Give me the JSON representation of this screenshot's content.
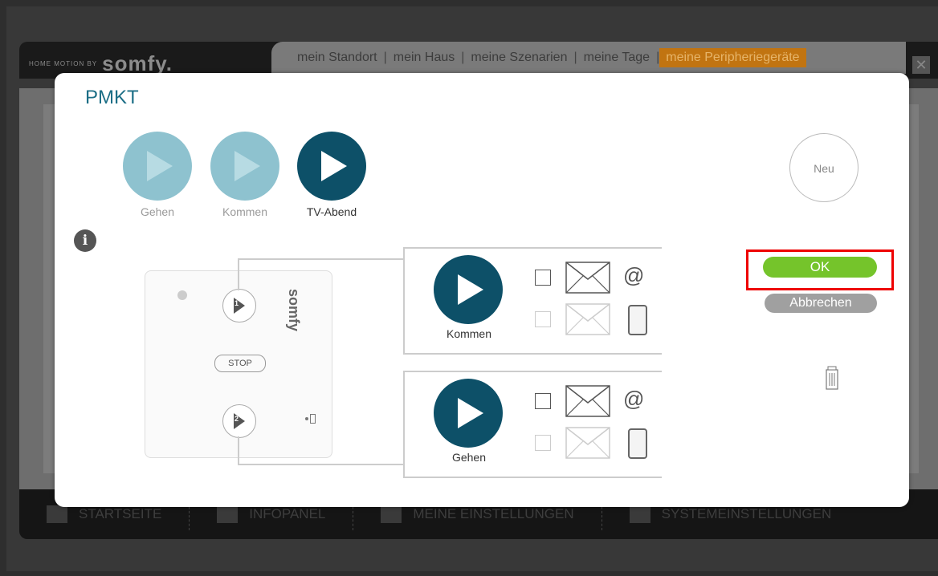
{
  "brand": {
    "tagline": "HOME MOTION BY",
    "logo": "somfy."
  },
  "nav_tabs": [
    "mein Standort",
    "mein Haus",
    "meine Szenarien",
    "meine Tage",
    "meine Peripheriegeräte"
  ],
  "active_tab": "meine Peripheriegeräte",
  "footer": [
    "STARTSEITE",
    "INFOPANEL",
    "MEINE EINSTELLUNGEN",
    "SYSTEMEINSTELLUNGEN"
  ],
  "dialog": {
    "title": "PMKT",
    "scenarios": [
      {
        "label": "Gehen",
        "active": false
      },
      {
        "label": "Kommen",
        "active": false
      },
      {
        "label": "TV-Abend",
        "active": true
      }
    ],
    "new_button": "Neu",
    "remote": {
      "logo": "somfy",
      "stop_label": "STOP",
      "btn1": "1",
      "btn2": "2"
    },
    "assignments": [
      {
        "label": "Kommen",
        "email_checked": false,
        "sms_checked": false
      },
      {
        "label": "Gehen",
        "email_checked": false,
        "sms_checked": false
      }
    ],
    "ok_label": "OK",
    "cancel_label": "Abbrechen"
  },
  "colors": {
    "accent": "#1c6e86",
    "ok": "#75c42b",
    "active_tab": "#c17411",
    "highlight": "#e00000"
  }
}
